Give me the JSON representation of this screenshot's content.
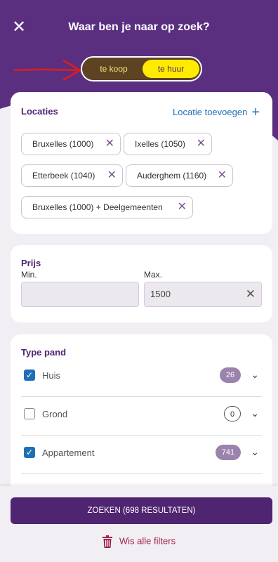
{
  "header": {
    "title": "Waar ben je naar op zoek?",
    "close_icon": "close-icon",
    "background_color": "#5a2f80"
  },
  "mode_toggle": {
    "options": [
      "te koop",
      "te huur"
    ],
    "selected": "te huur"
  },
  "locations": {
    "title": "Locaties",
    "add_label": "Locatie toevoegen",
    "chips": [
      "Bruxelles (1000)",
      "Ixelles (1050)",
      "Etterbeek (1040)",
      "Auderghem (1160)",
      "Bruxelles (1000) + Deelgemeenten"
    ]
  },
  "price": {
    "title": "Prijs",
    "min_label": "Min.",
    "max_label": "Max.",
    "min_value": "",
    "max_value": "1500"
  },
  "property_type": {
    "title": "Type pand",
    "items": [
      {
        "label": "Huis",
        "count": "26",
        "checked": true
      },
      {
        "label": "Grond",
        "count": "0",
        "checked": false
      },
      {
        "label": "Appartement",
        "count": "741",
        "checked": true
      }
    ]
  },
  "footer": {
    "search_button": "ZOEKEN (698 RESULTATEN)",
    "clear_filters": "Wis alle filters"
  },
  "colors": {
    "primary": "#4f2470",
    "accent_yellow": "#ffeb00",
    "link_blue": "#1f6fb5",
    "danger": "#a1244e"
  }
}
